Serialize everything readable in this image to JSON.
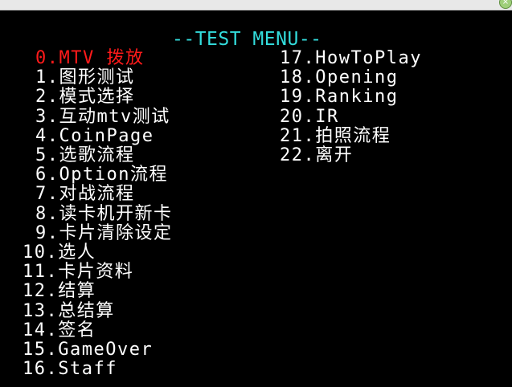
{
  "title": "--TEST MENU--",
  "colors": {
    "background": "#000000",
    "title": "#33dddd",
    "item": "#ffffff",
    "selected": "#ff1a1a"
  },
  "selected_index": 0,
  "left_items": [
    "0.MTV 拨放",
    "1.图形测试",
    "2.模式选择",
    "3.互动mtv测试",
    "4.CoinPage",
    "5.选歌流程",
    "6.Option流程",
    "7.对战流程",
    "8.读卡机开新卡",
    "9.卡片清除设定",
    "10.选人",
    "11.卡片资料",
    "12.结算",
    "13.总结算",
    "14.签名",
    "15.GameOver",
    "16.Staff"
  ],
  "right_items": [
    "17.HowToPlay",
    "18.Opening",
    "19.Ranking",
    "20.IR",
    "21.拍照流程",
    "22.离开"
  ]
}
